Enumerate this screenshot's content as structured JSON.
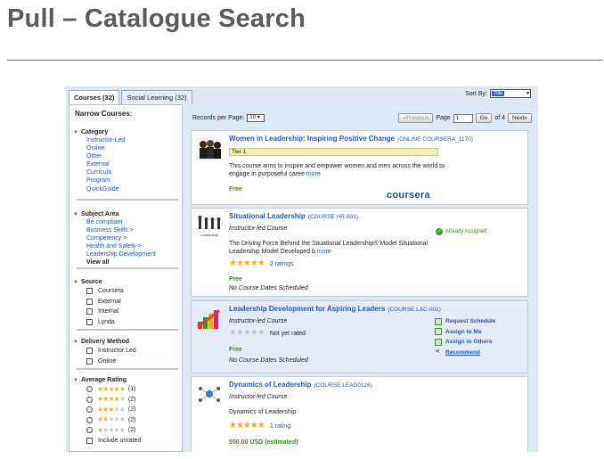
{
  "page": {
    "title": "Pull – Catalogue Search"
  },
  "tabs": [
    {
      "label": "Courses (32)",
      "active": true
    },
    {
      "label": "Social Learning (32)",
      "active": false
    }
  ],
  "sort": {
    "label": "Sort By:",
    "value": "Title"
  },
  "sidebar": {
    "title": "Narrow Courses:",
    "category": {
      "label": "Category",
      "items": [
        "Instructor-Led",
        "Online",
        "Other",
        "External",
        "Curricula",
        "Program",
        "QuickGuide"
      ]
    },
    "subject": {
      "label": "Subject Area",
      "items": [
        "Be compliant",
        "Business Skills >",
        "Competency >",
        "Health and Safety >",
        "Leadership Development"
      ],
      "view_all": "View all"
    },
    "source": {
      "label": "Source",
      "items": [
        "Coursera",
        "External",
        "Internal",
        "Lynda"
      ]
    },
    "delivery": {
      "label": "Delivery Method",
      "items": [
        "Instructor Led",
        "Online"
      ]
    },
    "rating": {
      "label": "Average Rating",
      "rows": [
        {
          "stars": 5,
          "count": "(1)"
        },
        {
          "stars": 4,
          "count": "(2)"
        },
        {
          "stars": 3,
          "count": "(2)"
        },
        {
          "stars": 2,
          "count": "(2)"
        },
        {
          "stars": 1,
          "count": "(2)"
        }
      ],
      "include_unrated": "Include unrated"
    }
  },
  "toolbar": {
    "records_label": "Records per Page:",
    "records_value": "10",
    "prev": "«Previous",
    "page_label": "Page",
    "page_value": "1",
    "go": "Go",
    "of": "of 4",
    "next": "Next»"
  },
  "courses": [
    {
      "title": "Women in Leadership: Inspiring Positive Change",
      "code": "(ONLINE COURSERA_1170)",
      "tier": "Tier 1",
      "description": "This course aims to inspire and empower women and men across the world to engage in purposeful caree",
      "more": "more",
      "price": "Free",
      "logo": "coursera"
    },
    {
      "title": "Situational Leadership",
      "code": "(COURSE HR-601)",
      "subtitle": "Instructor-led Course",
      "description": "The Driving Force Behind the Situational Leadership® Model Situational Leadership Model Developed b",
      "more": "more",
      "rating": 5,
      "rating_text": "2 ratings",
      "price": "Free",
      "dates": "No Course Dates Scheduled",
      "status": "Already Assigned",
      "thumb_text": "Leadership"
    },
    {
      "title": "Leadership Development for Aspiring Leaders",
      "code": "(COURSE LAC-001)",
      "subtitle": "Instructor-led Course",
      "rating": 0,
      "rating_text": "Not yet rated",
      "price": "Free",
      "dates": "No Course Dates Scheduled",
      "actions": [
        "Request Schedule",
        "Assign to Me",
        "Assign to Others",
        "Recommend"
      ]
    },
    {
      "title": "Dynamics of Leadership",
      "code": "(COURSE LEAD0126)",
      "subtitle": "Instructor-led Course",
      "description": "Dynamics of Leadership",
      "rating": 5,
      "rating_text": "1 rating",
      "price": "550.00 USD (estimated)"
    }
  ]
}
